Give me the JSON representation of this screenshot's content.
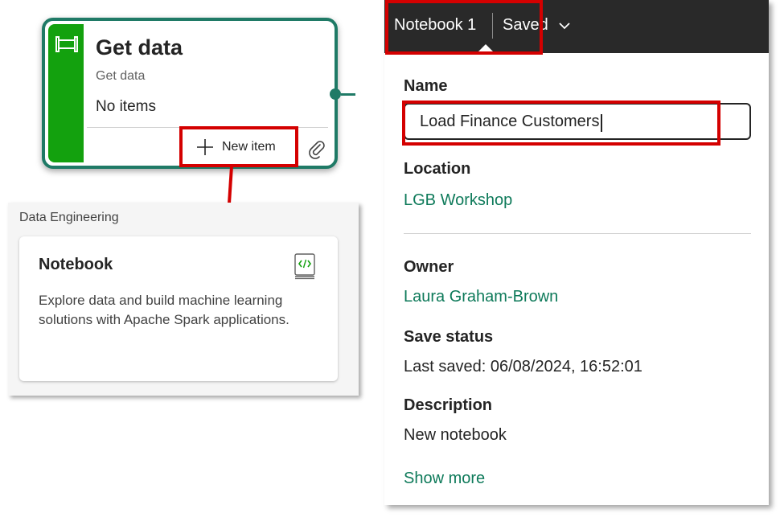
{
  "get_data_card": {
    "title": "Get data",
    "subtitle": "Get data",
    "empty_text": "No items",
    "new_item_label": "New item",
    "accent_color": "#13a10e",
    "border_color": "#1f7a66",
    "icon": "pipeline-icon"
  },
  "data_engineering": {
    "section_label": "Data Engineering",
    "notebook_card": {
      "title": "Notebook",
      "description": "Explore data and build machine learning solutions with Apache Spark applications.",
      "icon": "notebook-code-icon"
    }
  },
  "details": {
    "header": {
      "title": "Notebook 1",
      "status": "Saved",
      "chevron": "chevron-down-icon"
    },
    "name": {
      "label": "Name",
      "value": "Load Finance Customers"
    },
    "location": {
      "label": "Location",
      "value": "LGB Workshop"
    },
    "owner": {
      "label": "Owner",
      "value": "Laura Graham-Brown"
    },
    "save_status": {
      "label": "Save status",
      "value": "Last saved: 06/08/2024, 16:52:01"
    },
    "description": {
      "label": "Description",
      "value": "New notebook"
    },
    "show_more": "Show more",
    "link_color": "#0e7a5a",
    "header_color": "#292929"
  },
  "callout_color": "#d40000"
}
